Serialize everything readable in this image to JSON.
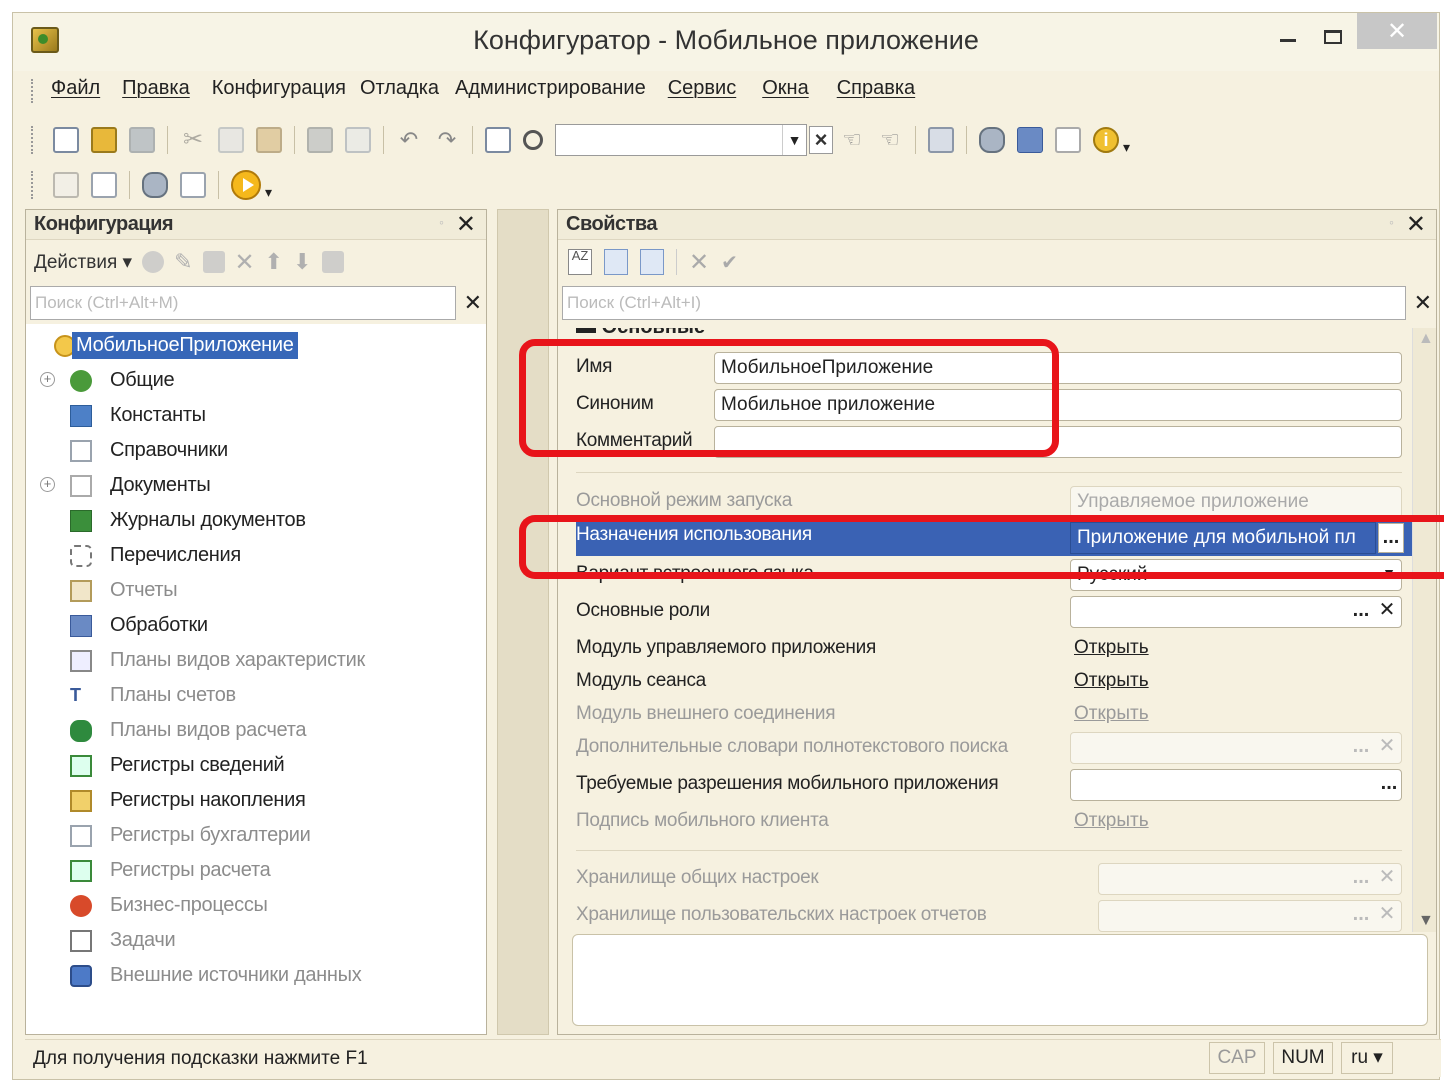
{
  "window": {
    "title": "Конфигуратор - Мобильное приложение"
  },
  "menu": [
    "Файл",
    "Правка",
    "Конфигурация",
    "Отладка",
    "Администрирование",
    "Сервис",
    "Окна",
    "Справка"
  ],
  "left_panel": {
    "title": "Конфигурация",
    "actions_label": "Действия",
    "search_placeholder": "Поиск (Ctrl+Alt+M)",
    "root": "МобильноеПриложение",
    "items": [
      {
        "label": "Общие",
        "icon": "shapes-icon",
        "expandable": true,
        "dim": false
      },
      {
        "label": "Константы",
        "icon": "constants-icon",
        "expandable": false,
        "dim": false
      },
      {
        "label": "Справочники",
        "icon": "catalog-icon",
        "expandable": false,
        "dim": false
      },
      {
        "label": "Документы",
        "icon": "document-icon",
        "expandable": true,
        "dim": false
      },
      {
        "label": "Журналы документов",
        "icon": "journal-icon",
        "expandable": false,
        "dim": false
      },
      {
        "label": "Перечисления",
        "icon": "enum-icon",
        "expandable": false,
        "dim": false
      },
      {
        "label": "Отчеты",
        "icon": "report-icon",
        "expandable": false,
        "dim": true
      },
      {
        "label": "Обработки",
        "icon": "processing-icon",
        "expandable": false,
        "dim": false
      },
      {
        "label": "Планы видов характеристик",
        "icon": "char-plan-icon",
        "expandable": false,
        "dim": true
      },
      {
        "label": "Планы счетов",
        "icon": "accounts-plan-icon",
        "expandable": false,
        "dim": true
      },
      {
        "label": "Планы видов расчета",
        "icon": "calc-plan-icon",
        "expandable": false,
        "dim": true
      },
      {
        "label": "Регистры сведений",
        "icon": "info-register-icon",
        "expandable": false,
        "dim": false
      },
      {
        "label": "Регистры накопления",
        "icon": "accum-register-icon",
        "expandable": false,
        "dim": false
      },
      {
        "label": "Регистры бухгалтерии",
        "icon": "acc-register-icon",
        "expandable": false,
        "dim": true
      },
      {
        "label": "Регистры расчета",
        "icon": "calc-register-icon",
        "expandable": false,
        "dim": true
      },
      {
        "label": "Бизнес-процессы",
        "icon": "business-process-icon",
        "expandable": false,
        "dim": true
      },
      {
        "label": "Задачи",
        "icon": "task-icon",
        "expandable": false,
        "dim": true
      },
      {
        "label": "Внешние источники данных",
        "icon": "external-source-icon",
        "expandable": false,
        "dim": true
      }
    ]
  },
  "right_panel": {
    "title": "Свойства",
    "search_placeholder": "Поиск (Ctrl+Alt+I)",
    "group_title": "Основные",
    "name_label": "Имя",
    "name_value": "МобильноеПриложение",
    "synonym_label": "Синоним",
    "synonym_value": "Мобильное приложение",
    "comment_label": "Комментарий",
    "comment_value": "",
    "run_mode_label": "Основной режим запуска",
    "run_mode_value": "Управляемое приложение",
    "purpose_label": "Назначения использования",
    "purpose_value": "Приложение для мобильной пл",
    "lang_label": "Вариант встроенного языка",
    "lang_value": "Русский",
    "roles_label": "Основные роли",
    "roles_value": "",
    "module_app_label": "Модуль управляемого приложения",
    "module_session_label": "Модуль сеанса",
    "module_ext_label": "Модуль внешнего соединения",
    "dict_label": "Дополнительные словари полнотекстового поиска",
    "perm_label": "Требуемые разрешения мобильного приложения",
    "signature_label": "Подпись мобильного клиента",
    "open_link": "Открыть",
    "storage_common_label": "Хранилище общих настроек",
    "storage_reports_label": "Хранилище пользовательских настроек отчетов"
  },
  "statusbar": {
    "hint": "Для получения подсказки нажмите F1",
    "cap": "CAP",
    "num": "NUM",
    "lang": "ru"
  },
  "colors": {
    "selection": "#3a62b4",
    "highlight": "#e8141a",
    "window_bg": "#f6f1e0"
  }
}
